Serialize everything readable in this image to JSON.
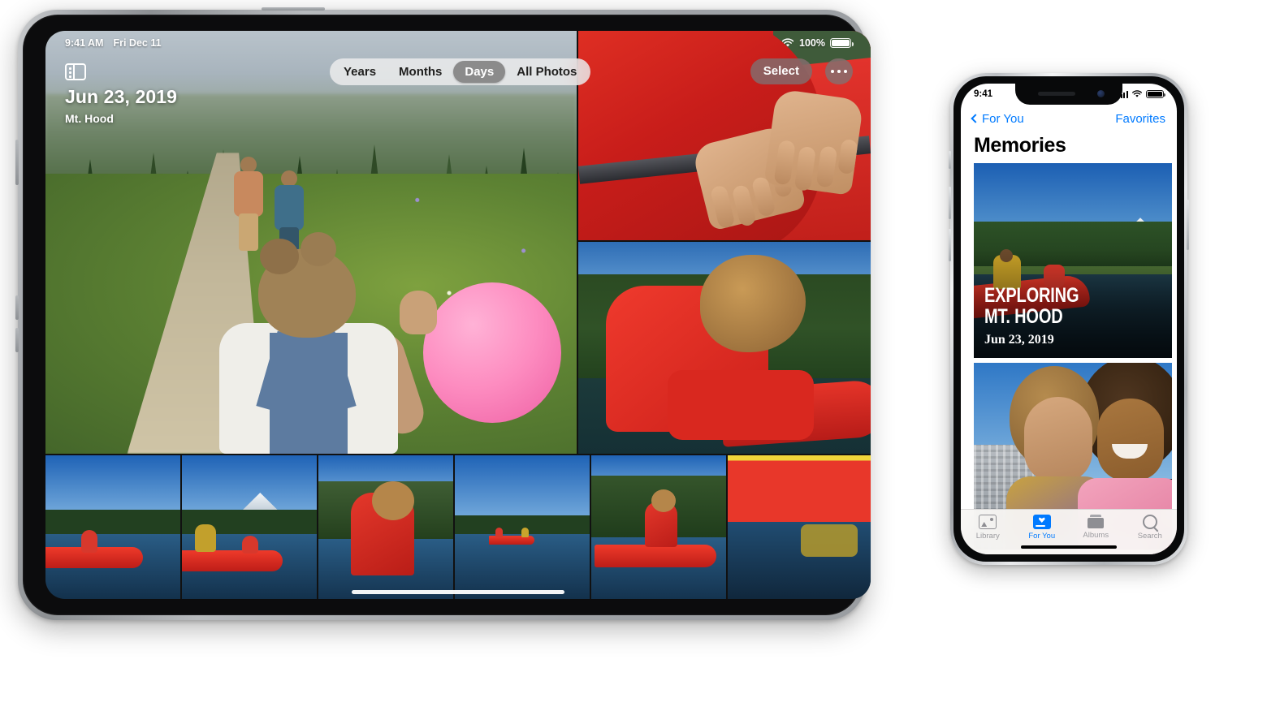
{
  "ipad": {
    "status_bar": {
      "time": "9:41 AM",
      "date": "Fri Dec 11",
      "wifi_icon": "wifi-icon",
      "battery_percent": "100%",
      "battery_icon": "battery-full-icon"
    },
    "sidebar_toggle_icon": "sidebar-toggle-icon",
    "header": {
      "date": "Jun 23, 2019",
      "location": "Mt. Hood"
    },
    "segmented_control": {
      "options": [
        "Years",
        "Months",
        "Days",
        "All Photos"
      ],
      "selected": "Days",
      "selected_bg": "#8b8b8b",
      "track_bg": "#eeeeee"
    },
    "toolbar": {
      "select_label": "Select",
      "more_icon": "ellipsis-icon"
    },
    "photos": [
      {
        "name": "hiking-trail-with-pink-balloon",
        "alt": "Two kids hiking a mountain trail, girl holding a pink balloon"
      },
      {
        "name": "hands-on-red-canoe",
        "alt": "Hands resting on the gunwale of a red canoe"
      },
      {
        "name": "woman-leaning-in-canoe",
        "alt": "Woman in red hoodie leaning over a red canoe by a forest lake"
      }
    ],
    "thumbnails": [
      {
        "name": "canoe-on-lake-1",
        "alt": "Red canoe on lake with forest"
      },
      {
        "name": "canoe-with-mt-hood",
        "alt": "Person in yellow jacket paddling red canoe with Mt. Hood"
      },
      {
        "name": "woman-in-red-hoodie",
        "alt": "Woman in red hoodie seated in canoe"
      },
      {
        "name": "distant-canoe-on-lake",
        "alt": "Distant red canoe on blue lake"
      },
      {
        "name": "woman-paddling-canoe",
        "alt": "Woman in red paddling red canoe"
      },
      {
        "name": "canoe-reflection",
        "alt": "Close-up of red canoe hull and reflection"
      }
    ],
    "home_indicator": "home-indicator"
  },
  "iphone": {
    "status_bar": {
      "time": "9:41",
      "cellular_icon": "cellular-bars-icon",
      "wifi_icon": "wifi-icon",
      "battery_icon": "battery-full-icon"
    },
    "nav_bar": {
      "back_label": "For You",
      "back_icon": "chevron-left-icon",
      "right_action": "Favorites"
    },
    "title": "Memories",
    "memories": [
      {
        "name": "memory-exploring-mt-hood",
        "title_line1": "EXPLORING",
        "title_line2": "MT. HOOD",
        "date": "Jun 23, 2019",
        "alt": "Two people in a red canoe on a forest lake"
      },
      {
        "name": "memory-selfie",
        "title_line1": "",
        "title_line2": "",
        "date": "",
        "alt": "Selfie of two smiling young women"
      }
    ],
    "tab_bar": {
      "tabs": [
        {
          "label": "Library",
          "icon": "photos-library-icon",
          "active": false
        },
        {
          "label": "For You",
          "icon": "for-you-icon",
          "active": true
        },
        {
          "label": "Albums",
          "icon": "albums-icon",
          "active": false
        },
        {
          "label": "Search",
          "icon": "search-icon",
          "active": false
        }
      ],
      "accent_color": "#007aff",
      "inactive_color": "#8e8e93"
    },
    "home_indicator": "home-indicator"
  }
}
